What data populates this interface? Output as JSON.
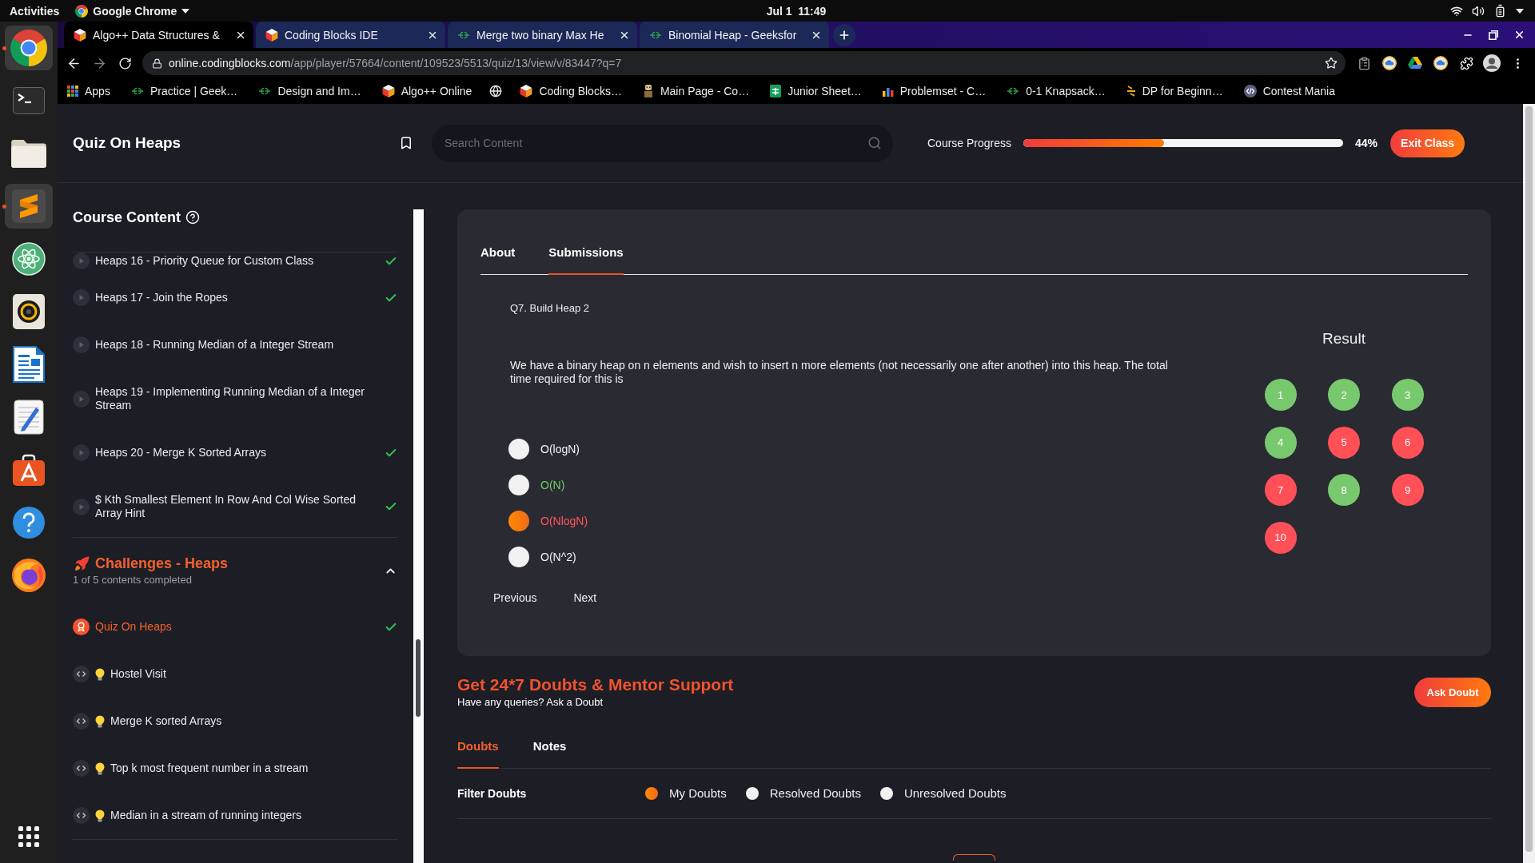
{
  "system_bar": {
    "activities": "Activities",
    "app_menu": "Google Chrome",
    "clock": "Jul 1  11:49"
  },
  "dock": [
    {
      "running": true
    },
    {
      "running": false
    },
    {
      "running": false
    },
    {
      "running": true
    },
    {
      "running": false
    },
    {
      "running": false
    },
    {
      "running": false
    },
    {
      "running": false
    },
    {
      "running": false
    },
    {
      "running": false
    },
    {
      "running": false
    }
  ],
  "browser": {
    "tabs": [
      {
        "title": "Algo++ Data Structures &",
        "selected": true
      },
      {
        "title": "Coding Blocks IDE",
        "selected": false
      },
      {
        "title": "Merge two binary Max He",
        "selected": false
      },
      {
        "title": "Binomial Heap - Geeksfor",
        "selected": false
      }
    ],
    "address": {
      "host": "online.codingblocks.com",
      "path": "/app/player/57664/content/109523/5513/quiz/13/view/v/83447?q=7"
    },
    "bookmarks": [
      {
        "kind": "link",
        "title": "Apps"
      },
      {
        "kind": "link",
        "title": "Practice | Geek…"
      },
      {
        "kind": "link",
        "title": "Design and Im…"
      },
      {
        "kind": "link",
        "title": "Algo++ Online"
      },
      {
        "kind": "icon"
      },
      {
        "kind": "link",
        "title": "Coding Blocks…"
      },
      {
        "kind": "link",
        "title": "Main Page - Co…"
      },
      {
        "kind": "link",
        "title": "Junior Sheet…"
      },
      {
        "kind": "link",
        "title": "Problemset - C…"
      },
      {
        "kind": "link",
        "title": "0-1 Knapsack…"
      },
      {
        "kind": "link",
        "title": "DP for Beginn…"
      },
      {
        "kind": "link",
        "title": "Contest Mania"
      }
    ]
  },
  "header": {
    "title": "Quiz On Heaps",
    "search": {
      "placeholder": "Search Content"
    },
    "progress": {
      "label": "Course Progress",
      "level": 0.44,
      "reading": "44%"
    },
    "exit_button": "Exit Class"
  },
  "sidebar": {
    "title": "Course Content",
    "lessons": [
      {
        "title": "Heaps 16 - Priority Queue for Custom Class",
        "done": true,
        "selected": false
      },
      {
        "title": "Heaps 17 - Join the Ropes",
        "done": true,
        "selected": false
      },
      {
        "title": "Heaps 18 - Running Median of a Integer Stream",
        "done": false,
        "selected": false
      },
      {
        "title": "Heaps 19 - Implementing Running Median of a Integer Stream",
        "done": false,
        "selected": false
      },
      {
        "title": "Heaps 20 - Merge K Sorted Arrays",
        "done": true,
        "selected": false
      },
      {
        "title": "$ Kth Smallest Element In Row And Col Wise Sorted Array Hint",
        "done": true,
        "selected": false
      }
    ],
    "section": {
      "title": "Challenges - Heaps",
      "subtitle": "1 of 5 contents completed",
      "expanded": true,
      "items": [
        {
          "kind": "quiz",
          "title": "Quiz On Heaps",
          "done": true,
          "selected": true
        },
        {
          "kind": "code",
          "title": "Hostel Visit",
          "done": false,
          "selected": false
        },
        {
          "kind": "code",
          "title": "Merge K sorted Arrays",
          "done": false,
          "selected": false
        },
        {
          "kind": "code",
          "title": "Top k most frequent number in a stream",
          "done": false,
          "selected": false
        },
        {
          "kind": "code",
          "title": "Median in a stream of running integers",
          "done": false,
          "selected": false
        }
      ]
    }
  },
  "quiz": {
    "tabs": [
      {
        "label": "About",
        "selected": false
      },
      {
        "label": "Submissions",
        "selected": true
      }
    ],
    "question_number": "Q7. Build Heap 2",
    "question": "We have a binary heap on n elements and wish to insert n more elements (not necessarily one after another) into this heap. The total time required for this is",
    "options": [
      {
        "label": "O(logN)",
        "selected": false,
        "correct": false
      },
      {
        "label": "O(N)",
        "selected": false,
        "correct": true
      },
      {
        "label": "O(NlogN)",
        "selected": true,
        "correct": false
      },
      {
        "label": "O(N^2)",
        "selected": false,
        "correct": false
      }
    ],
    "nav": [
      "Previous",
      "Next"
    ],
    "result": {
      "title": "Result",
      "questions": [
        {
          "number": "1",
          "correct": true
        },
        {
          "number": "2",
          "correct": true
        },
        {
          "number": "3",
          "correct": true
        },
        {
          "number": "4",
          "correct": true
        },
        {
          "number": "5",
          "correct": false
        },
        {
          "number": "6",
          "correct": false
        },
        {
          "number": "7",
          "correct": false
        },
        {
          "number": "8",
          "correct": true
        },
        {
          "number": "9",
          "correct": false
        },
        {
          "number": "10",
          "correct": false
        }
      ]
    }
  },
  "support": {
    "title": "Get 24*7 Doubts & Mentor Support",
    "subtitle": "Have any queries? Ask a Doubt",
    "button": "Ask Doubt",
    "tabs": [
      {
        "label": "Doubts",
        "selected": true
      },
      {
        "label": "Notes",
        "selected": false
      }
    ],
    "filter": {
      "label": "Filter Doubts",
      "options": [
        {
          "label": "My Doubts",
          "selected": true
        },
        {
          "label": "Resolved Doubts",
          "selected": false
        },
        {
          "label": "Unresolved Doubts",
          "selected": false
        }
      ]
    }
  }
}
